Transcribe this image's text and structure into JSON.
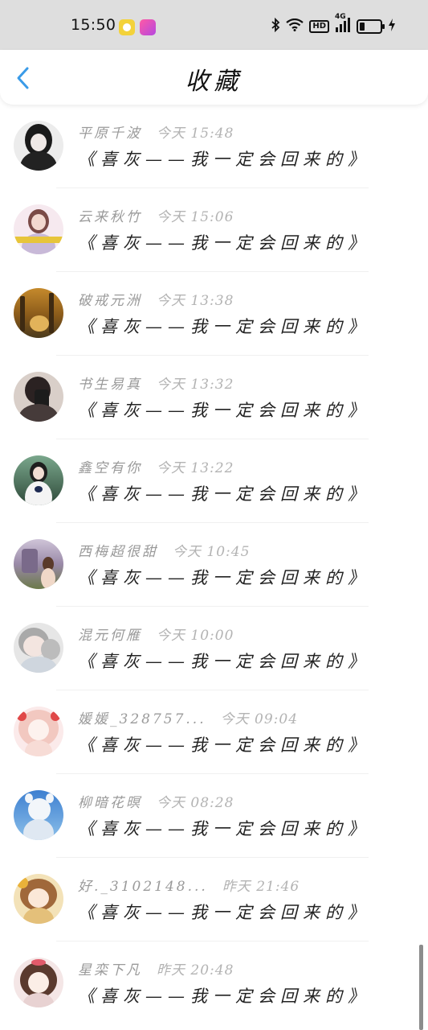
{
  "status_bar": {
    "time": "15:50",
    "network": "4G",
    "hd": "HD"
  },
  "header": {
    "title": "收藏",
    "accent": "#3a9be8"
  },
  "favorites": [
    {
      "user": "平原千波",
      "time": "今天 15:48",
      "work": "《喜灰——我一定会回来的》"
    },
    {
      "user": "云来秋竹",
      "time": "今天 15:06",
      "work": "《喜灰——我一定会回来的》"
    },
    {
      "user": "破戒元洲",
      "time": "今天 13:38",
      "work": "《喜灰——我一定会回来的》"
    },
    {
      "user": "书生易真",
      "time": "今天 13:32",
      "work": "《喜灰——我一定会回来的》"
    },
    {
      "user": "鑫空有你",
      "time": "今天 13:22",
      "work": "《喜灰——我一定会回来的》"
    },
    {
      "user": "西梅超很甜",
      "time": "今天 10:45",
      "work": "《喜灰——我一定会回来的》"
    },
    {
      "user": "混元何雁",
      "time": "今天 10:00",
      "work": "《喜灰——我一定会回来的》"
    },
    {
      "user": "媛媛_328757...",
      "time": "今天 09:04",
      "work": "《喜灰——我一定会回来的》"
    },
    {
      "user": "柳暗花暝",
      "time": "今天 08:28",
      "work": "《喜灰——我一定会回来的》"
    },
    {
      "user": "好._3102148...",
      "time": "昨天 21:46",
      "work": "《喜灰——我一定会回来的》"
    },
    {
      "user": "星栾下凡",
      "time": "昨天 20:48",
      "work": "《喜灰——我一定会回来的》"
    }
  ]
}
